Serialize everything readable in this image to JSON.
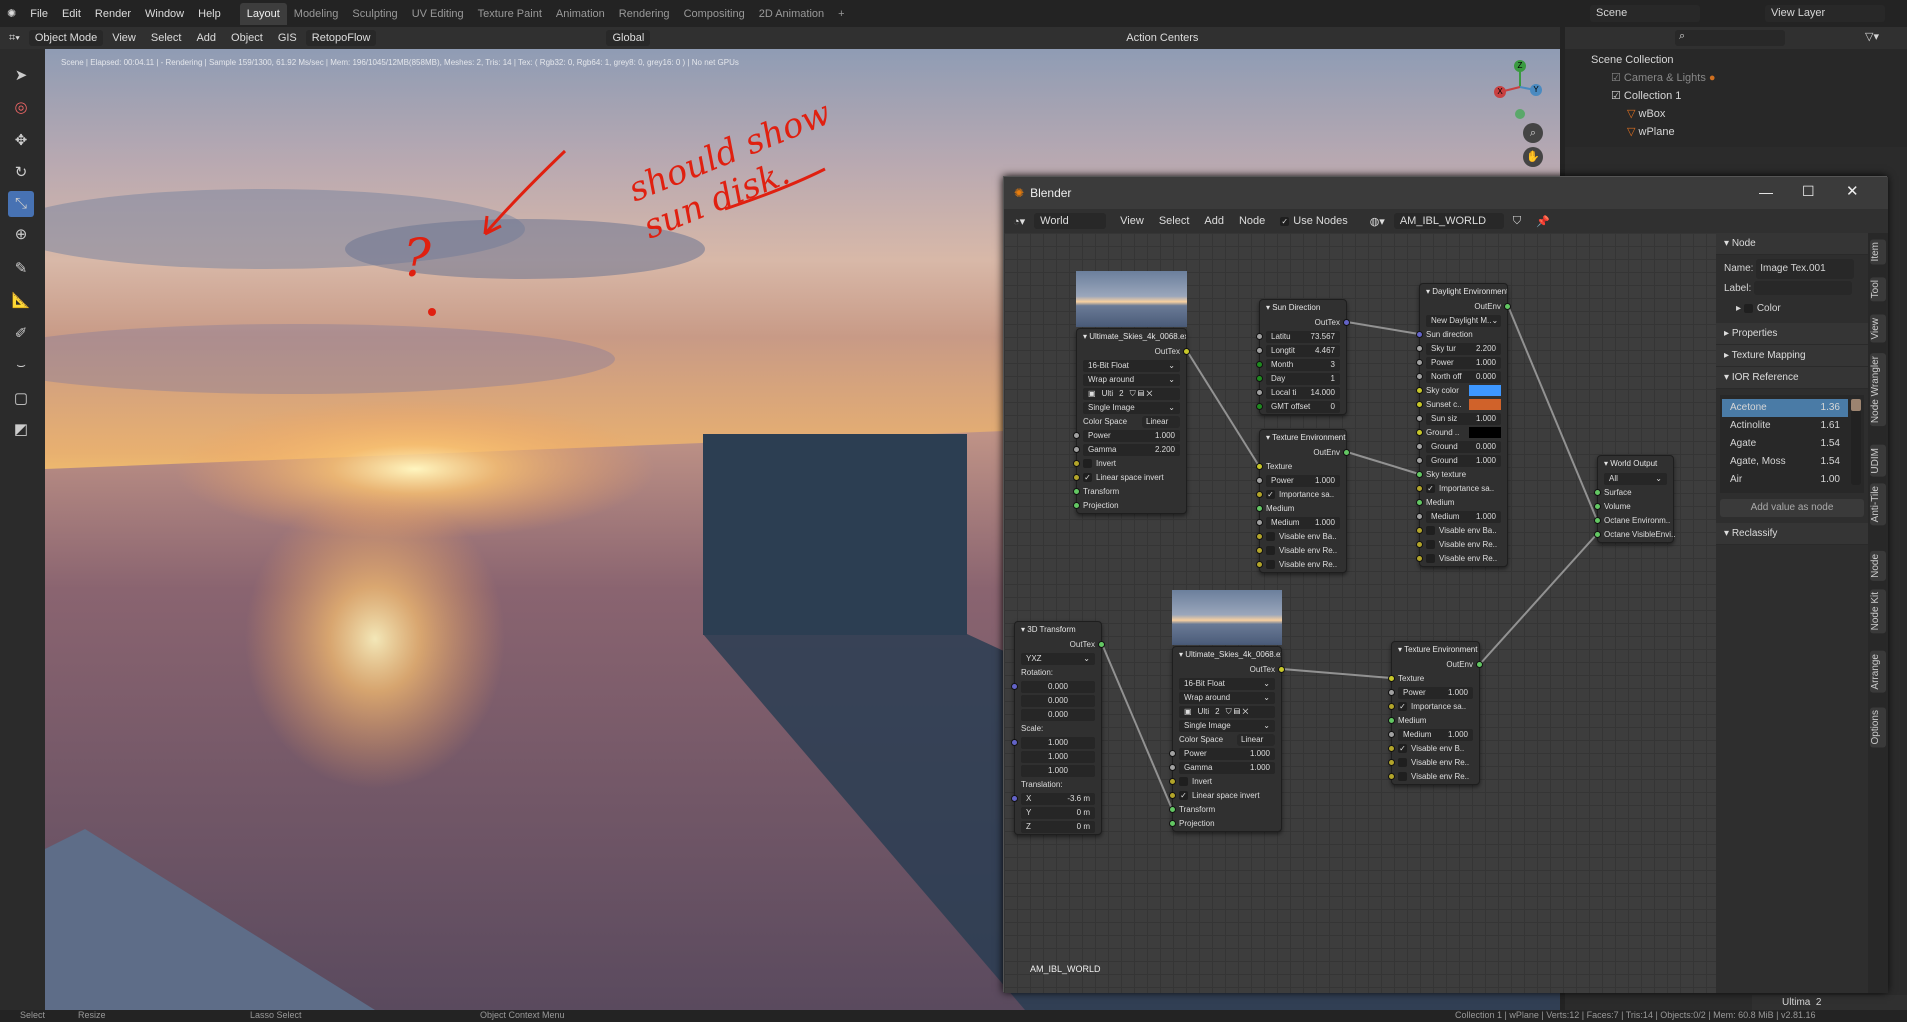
{
  "menubar": {
    "items": [
      "File",
      "Edit",
      "Render",
      "Window",
      "Help"
    ],
    "workspaces": [
      "Layout",
      "Modeling",
      "Sculpting",
      "UV Editing",
      "Texture Paint",
      "Animation",
      "Rendering",
      "Compositing",
      "2D Animation"
    ],
    "active_workspace": "Layout",
    "scene": "Scene",
    "view_layer": "View Layer"
  },
  "header": {
    "mode": "Object Mode",
    "items": [
      "View",
      "Select",
      "Add",
      "Object"
    ],
    "gis": "GIS",
    "retopoflow": "RetopoFlow",
    "orientation": "Global",
    "action_centers": "Action Centers"
  },
  "viewport": {
    "render_status": "Scene | Elapsed: 00:04.11 | - Rendering | Sample 159/1300, 61.92 Ms/sec | Mem: 196/1045/12MB(858MB), Meshes: 2, Tris: 14 | Tex: ( Rgb32: 0, Rgb64: 1, grey8: 0, grey16: 0 ) | No net GPUs",
    "annotation": "should show sun disk.",
    "annotation_mark": "?",
    "gizmo": {
      "x": "X",
      "y": "Y",
      "z": "Z"
    }
  },
  "outliner": {
    "root": "Scene Collection",
    "rows": [
      {
        "label": "Camera & Lights",
        "dim": true
      },
      {
        "label": "Collection 1"
      },
      {
        "label": "wBox"
      },
      {
        "label": "wPlane"
      }
    ]
  },
  "node_window": {
    "title": "Blender",
    "editor": "World",
    "menus": [
      "View",
      "Select",
      "Add",
      "Node"
    ],
    "use_nodes": "Use Nodes",
    "world_name": "AM_IBL_WORLD",
    "canvas_label": "AM_IBL_WORLD",
    "nodes": {
      "img1": {
        "title": "Ultimate_Skies_4k_0068.exr",
        "rows": [
          {
            "t": "out",
            "label": "OutTex",
            "s": "yellow"
          },
          {
            "t": "select",
            "label": "16-Bit Float"
          },
          {
            "t": "select",
            "label": "Wrap around"
          },
          {
            "t": "imgbar",
            "label": "Ulti",
            "count": "2"
          },
          {
            "t": "select",
            "label": "Single Image"
          },
          {
            "t": "pair",
            "label": "Color Space",
            "value": "Linear"
          },
          {
            "t": "field",
            "label": "Power",
            "value": "1.000",
            "s": "grey"
          },
          {
            "t": "field",
            "label": "Gamma",
            "value": "2.200",
            "s": "grey"
          },
          {
            "t": "check",
            "label": "Invert",
            "checked": false,
            "s": "olive"
          },
          {
            "t": "check",
            "label": "Linear space invert",
            "checked": true,
            "s": "olive"
          },
          {
            "t": "in",
            "label": "Transform",
            "s": "green"
          },
          {
            "t": "in",
            "label": "Projection",
            "s": "green"
          }
        ]
      },
      "sun": {
        "title": "Sun Direction",
        "rows": [
          {
            "t": "out",
            "label": "OutTex",
            "s": "purple"
          },
          {
            "t": "field",
            "label": "Latitu",
            "value": "73.567",
            "s": "grey"
          },
          {
            "t": "field",
            "label": "Longtit",
            "value": "4.467",
            "s": "grey"
          },
          {
            "t": "field",
            "label": "Month",
            "value": "3",
            "s": "dgreen"
          },
          {
            "t": "field",
            "label": "Day",
            "value": "1",
            "s": "dgreen"
          },
          {
            "t": "field",
            "label": "Local ti",
            "value": "14.000",
            "s": "grey"
          },
          {
            "t": "field",
            "label": "GMT offset",
            "value": "0",
            "s": "dgreen"
          }
        ]
      },
      "tex1": {
        "title": "Texture Environment",
        "rows": [
          {
            "t": "out",
            "label": "OutEnv",
            "s": "green"
          },
          {
            "t": "in",
            "label": "Texture",
            "s": "yellow"
          },
          {
            "t": "field",
            "label": "Power",
            "value": "1.000",
            "s": "grey"
          },
          {
            "t": "check",
            "label": "Importance sa..",
            "checked": true,
            "s": "olive"
          },
          {
            "t": "in",
            "label": "Medium",
            "s": "green"
          },
          {
            "t": "field",
            "label": "Medium",
            "value": "1.000",
            "s": "grey"
          },
          {
            "t": "check",
            "label": "Visable env Ba..",
            "checked": false,
            "s": "olive"
          },
          {
            "t": "check",
            "label": "Visable env Re..",
            "checked": false,
            "s": "olive"
          },
          {
            "t": "check",
            "label": "Visable env Re..",
            "checked": false,
            "s": "olive"
          }
        ]
      },
      "day": {
        "title": "Daylight Environment",
        "rows": [
          {
            "t": "out",
            "label": "OutEnv",
            "s": "green"
          },
          {
            "t": "select",
            "label": "New Daylight M.."
          },
          {
            "t": "in",
            "label": "Sun direction",
            "s": "purple"
          },
          {
            "t": "field",
            "label": "Sky tur",
            "value": "2.200",
            "s": "grey"
          },
          {
            "t": "field",
            "label": "Power",
            "value": "1.000",
            "s": "grey"
          },
          {
            "t": "field",
            "label": "North off",
            "value": "0.000",
            "s": "grey"
          },
          {
            "t": "color",
            "label": "Sky color",
            "color": "#3d97ff",
            "s": "yellow"
          },
          {
            "t": "color",
            "label": "Sunset c..",
            "color": "#d0622a",
            "s": "yellow"
          },
          {
            "t": "field",
            "label": "Sun siz",
            "value": "1.000",
            "s": "grey"
          },
          {
            "t": "color",
            "label": "Ground ..",
            "color": "#000000",
            "s": "yellow"
          },
          {
            "t": "field",
            "label": "Ground",
            "value": "0.000",
            "s": "grey"
          },
          {
            "t": "field",
            "label": "Ground",
            "value": "1.000",
            "s": "grey"
          },
          {
            "t": "in",
            "label": "Sky texture",
            "s": "green"
          },
          {
            "t": "check",
            "label": "Importance sa..",
            "checked": true,
            "s": "olive"
          },
          {
            "t": "in",
            "label": "Medium",
            "s": "green"
          },
          {
            "t": "field",
            "label": "Medium",
            "value": "1.000",
            "s": "grey"
          },
          {
            "t": "check",
            "label": "Visable env Ba..",
            "checked": false,
            "s": "olive"
          },
          {
            "t": "check",
            "label": "Visable env Re..",
            "checked": false,
            "s": "olive"
          },
          {
            "t": "check",
            "label": "Visable env Re..",
            "checked": false,
            "s": "olive"
          }
        ]
      },
      "wout": {
        "title": "World Output",
        "rows": [
          {
            "t": "select",
            "label": "All"
          },
          {
            "t": "in",
            "label": "Surface",
            "s": "green"
          },
          {
            "t": "in",
            "label": "Volume",
            "s": "green"
          },
          {
            "t": "in",
            "label": "Octane Environm..",
            "s": "green"
          },
          {
            "t": "in",
            "label": "Octane VisibleEnvi..",
            "s": "green"
          }
        ]
      },
      "xf": {
        "title": "3D Transform",
        "rows": [
          {
            "t": "out",
            "label": "OutTex",
            "s": "green"
          },
          {
            "t": "select",
            "label": "YXZ"
          },
          {
            "t": "text",
            "label": "Rotation:"
          },
          {
            "t": "val",
            "value": "0.000",
            "s": "purple"
          },
          {
            "t": "val",
            "value": "0.000"
          },
          {
            "t": "val",
            "value": "0.000"
          },
          {
            "t": "text",
            "label": "Scale:"
          },
          {
            "t": "val",
            "value": "1.000",
            "s": "purple"
          },
          {
            "t": "val",
            "value": "1.000"
          },
          {
            "t": "val",
            "value": "1.000"
          },
          {
            "t": "text",
            "label": "Translation:"
          },
          {
            "t": "field",
            "label": "X",
            "value": "-3.6 m",
            "s": "purple"
          },
          {
            "t": "field",
            "label": "Y",
            "value": "0 m"
          },
          {
            "t": "field",
            "label": "Z",
            "value": "0 m"
          }
        ]
      },
      "img2": {
        "title": "Ultimate_Skies_4k_0068.exr",
        "rows": [
          {
            "t": "out",
            "label": "OutTex",
            "s": "yellow"
          },
          {
            "t": "select",
            "label": "16-Bit Float"
          },
          {
            "t": "select",
            "label": "Wrap around"
          },
          {
            "t": "imgbar",
            "label": "Ulti",
            "count": "2"
          },
          {
            "t": "select",
            "label": "Single Image"
          },
          {
            "t": "pair",
            "label": "Color Space",
            "value": "Linear"
          },
          {
            "t": "field",
            "label": "Power",
            "value": "1.000",
            "s": "grey"
          },
          {
            "t": "field",
            "label": "Gamma",
            "value": "1.000",
            "s": "grey"
          },
          {
            "t": "check",
            "label": "Invert",
            "checked": false,
            "s": "olive"
          },
          {
            "t": "check",
            "label": "Linear space invert",
            "checked": true,
            "s": "olive"
          },
          {
            "t": "in",
            "label": "Transform",
            "s": "green"
          },
          {
            "t": "in",
            "label": "Projection",
            "s": "green"
          }
        ]
      },
      "tex2": {
        "title": "Texture Environment",
        "rows": [
          {
            "t": "out",
            "label": "OutEnv",
            "s": "green"
          },
          {
            "t": "in",
            "label": "Texture",
            "s": "yellow"
          },
          {
            "t": "field",
            "label": "Power",
            "value": "1.000",
            "s": "grey"
          },
          {
            "t": "check",
            "label": "Importance sa..",
            "checked": true,
            "s": "olive"
          },
          {
            "t": "in",
            "label": "Medium",
            "s": "green"
          },
          {
            "t": "field",
            "label": "Medium",
            "value": "1.000",
            "s": "grey"
          },
          {
            "t": "check",
            "label": "Visable env B..",
            "checked": true,
            "s": "olive"
          },
          {
            "t": "check",
            "label": "Visable env Re..",
            "checked": false,
            "s": "olive"
          },
          {
            "t": "check",
            "label": "Visable env Re..",
            "checked": false,
            "s": "olive"
          }
        ]
      }
    }
  },
  "sidebar": {
    "node_section": "Node",
    "name_label": "Name:",
    "name_value": "Image Tex.001",
    "label_label": "Label:",
    "color_label": "Color",
    "sections": [
      "Properties",
      "Texture Mapping",
      "IOR Reference"
    ],
    "ior": [
      {
        "name": "Acetone",
        "value": "1.36",
        "selected": true
      },
      {
        "name": "Actinolite",
        "value": "1.61"
      },
      {
        "name": "Agate",
        "value": "1.54"
      },
      {
        "name": "Agate, Moss",
        "value": "1.54"
      },
      {
        "name": "Air",
        "value": "1.00"
      }
    ],
    "add_value": "Add value as node",
    "reclassify": "Reclassify",
    "tabs": [
      "Item",
      "Tool",
      "View",
      "Node Wrangler",
      "UDIM",
      "Anti-Tile",
      "Node",
      "Node Kit",
      "Arrange",
      "Options"
    ]
  },
  "image_header": {
    "name": "Ultima",
    "users": "2"
  },
  "statusbar": {
    "left": [
      "Select",
      "Resize",
      "Lasso Select",
      "Object Context Menu"
    ],
    "right": "Collection 1 | wPlane | Verts:12 | Faces:7 | Tris:14 | Objects:0/2 | Mem: 60.8 MiB | v2.81.16"
  },
  "colors": {
    "accent": "#4772b3",
    "socket_yellow": "#c7c729",
    "socket_green": "#63c763",
    "socket_purple": "#6363c7",
    "annotation": "#e02010"
  }
}
